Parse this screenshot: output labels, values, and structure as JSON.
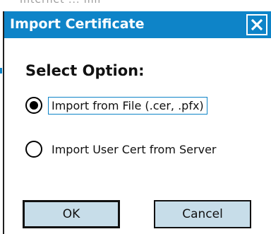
{
  "background": {
    "partial_text": "Internet ... mil"
  },
  "dialog": {
    "title": "Import Certificate",
    "close_label": "X",
    "heading": "Select Option:",
    "options": [
      {
        "label": "Import from File  (.cer, .pfx)",
        "checked": true
      },
      {
        "label": "Import User Cert from Server",
        "checked": false
      }
    ],
    "buttons": {
      "ok": "OK",
      "cancel": "Cancel"
    }
  },
  "colors": {
    "titlebar": "#0e84c8",
    "button_bg": "#c7dde9"
  }
}
